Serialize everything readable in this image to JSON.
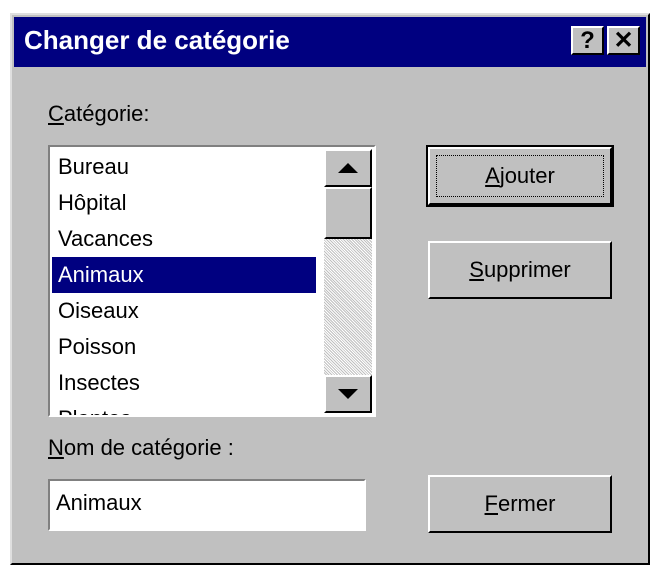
{
  "window": {
    "title": "Changer de catégorie",
    "help_label": "?",
    "close_label": "✕"
  },
  "category_list": {
    "label_mnemonic": "C",
    "label_rest": "atégorie:",
    "items": [
      "Bureau",
      "Hôpital",
      "Vacances",
      "Animaux",
      "Oiseaux",
      "Poisson",
      "Insectes",
      "Plantes"
    ],
    "selected": "Animaux"
  },
  "name_field": {
    "label_mnemonic": "N",
    "label_rest": "om de catégorie :",
    "value": "Animaux"
  },
  "buttons": {
    "add": {
      "mnemonic": "A",
      "rest": "jouter"
    },
    "delete": {
      "mnemonic": "S",
      "rest": "upprimer"
    },
    "close": {
      "mnemonic": "F",
      "rest": "ermer"
    }
  },
  "icons": {
    "scroll_up": "arrow-up-icon",
    "scroll_down": "arrow-down-icon"
  },
  "colors": {
    "titlebar": "#000080",
    "face": "#c0c0c0",
    "selection": "#000080"
  }
}
